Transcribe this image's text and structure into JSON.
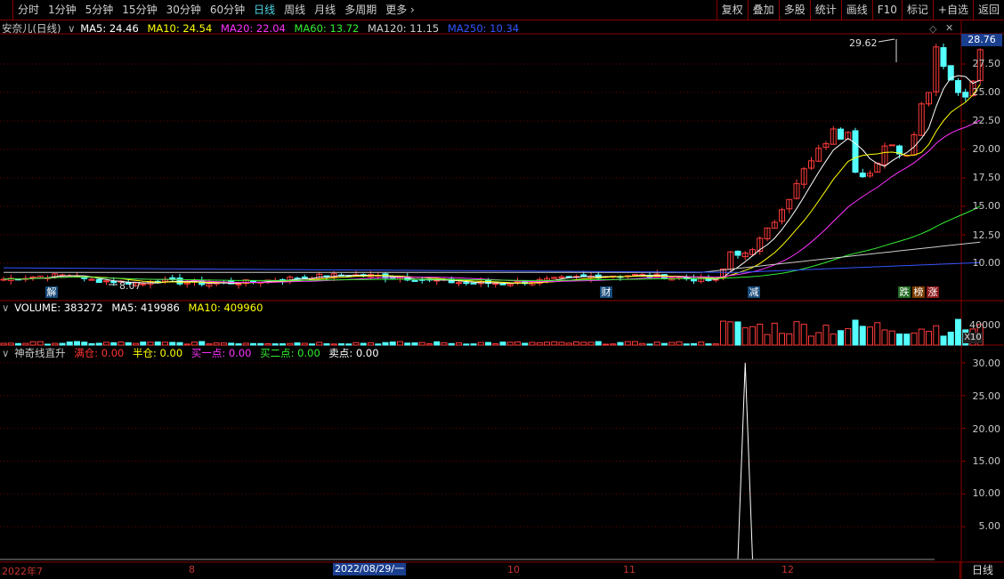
{
  "toolbar": {
    "periods": [
      "分时",
      "1分钟",
      "5分钟",
      "15分钟",
      "30分钟",
      "60分钟",
      "日线",
      "周线",
      "月线",
      "多周期"
    ],
    "active_period": "日线",
    "more": "更多",
    "right_buttons": [
      "复权",
      "叠加",
      "多股",
      "统计",
      "画线",
      "F10",
      "标记",
      "+自选",
      "返回"
    ]
  },
  "main_chart": {
    "title": "安奈儿(日线)",
    "ma": [
      {
        "label": "MA5: 24.46",
        "color": "#ffffff"
      },
      {
        "label": "MA10: 24.54",
        "color": "#ffff00"
      },
      {
        "label": "MA20: 22.04",
        "color": "#ff33ff"
      },
      {
        "label": "MA60: 13.72",
        "color": "#33ee33"
      },
      {
        "label": "MA120: 11.15",
        "color": "#cccccc"
      },
      {
        "label": "MA250: 10.34",
        "color": "#3355ff"
      }
    ],
    "current_price": "28.76",
    "y_ticks": [
      "27.50",
      "25.00",
      "22.50",
      "20.00",
      "17.50",
      "15.00",
      "12.50",
      "10.00"
    ],
    "high_label": "29.62",
    "low_label": "8.07",
    "markers": [
      "解",
      "财",
      "减",
      "跌",
      "榜",
      "涨"
    ]
  },
  "volume": {
    "legend": [
      {
        "label": "VOLUME: 383272",
        "color": "#ffffff"
      },
      {
        "label": "MA5: 419986",
        "color": "#ffffff"
      },
      {
        "label": "MA10: 409960",
        "color": "#ffff00"
      }
    ],
    "y_tick": "40000",
    "unit": "X10"
  },
  "indicator": {
    "title": "神奇线直升",
    "legend": [
      {
        "label": "满仓: 0.00",
        "color": "#ff3333"
      },
      {
        "label": "半仓: 0.00",
        "color": "#ffff00"
      },
      {
        "label": "买一点: 0.00",
        "color": "#ff33ff"
      },
      {
        "label": "买二点: 0.00",
        "color": "#33ee33"
      },
      {
        "label": "卖点: 0.00",
        "color": "#ffffff"
      }
    ],
    "y_ticks": [
      "30.00",
      "25.00",
      "20.00",
      "15.00",
      "10.00",
      "5.00"
    ]
  },
  "x_axis": {
    "labels": [
      "2022年7",
      "8",
      "2022/08/29/一",
      "10",
      "11",
      "12"
    ],
    "period_button": "日线"
  },
  "colors": {
    "up": "#ff3b3b",
    "down": "#54ffff",
    "frame": "#8b0000",
    "ma5": "#ffffff",
    "ma10": "#ffff00",
    "ma20": "#ff33ff",
    "ma60": "#33ee33",
    "ma120": "#cccccc",
    "ma250": "#3355ff"
  }
}
